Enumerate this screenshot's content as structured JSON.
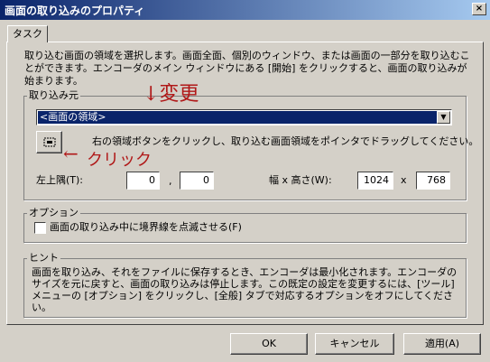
{
  "window": {
    "title": "画面の取り込みのプロパティ",
    "close_label": "×"
  },
  "tab": {
    "label": "タスク"
  },
  "description": "取り込む画面の領域を選択します。画面全面、個別のウィンドウ、または画面の一部分を取り込むことができます。エンコーダのメイン ウィンドウにある [開始] をクリックすると、画面の取り込みが始まります。",
  "source_group": {
    "legend": "取り込み元",
    "selected": "<画面の領域>",
    "instruction": "右の領域ボタンをクリックし、取り込む画面領域をポインタでドラッグしてください。",
    "top_left_label": "左上隅(T):",
    "x_value": "0",
    "y_value": "0",
    "separator": ",",
    "size_label": "幅 x 高さ(W):",
    "width_value": "1024",
    "height_value": "768",
    "times": "x"
  },
  "options_group": {
    "legend": "オプション",
    "checkbox_label": "画面の取り込み中に境界線を点滅させる(F)"
  },
  "hint_group": {
    "legend": "ヒント",
    "text": "画面を取り込み、それをファイルに保存するとき、エンコーダは最小化されます。エンコーダのサイズを元に戻すと、画面の取り込みは停止します。この既定の設定を変更するには、[ツール] メニューの [オプション] をクリックし、[全般] タブで対応するオプションをオフにしてください。"
  },
  "buttons": {
    "ok": "OK",
    "cancel": "キャンセル",
    "apply": "適用(A)"
  },
  "annotations": {
    "change": "↓変更",
    "click": "クリック"
  },
  "colors": {
    "titlebar": "#0a246a",
    "face": "#d4d0c8",
    "annotation": "#b01818"
  }
}
